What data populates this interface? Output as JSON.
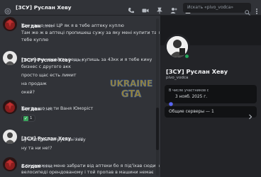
{
  "header": {
    "title": "[ЗСУ] Руслан Хеву",
    "tools": [
      "phone-icon",
      "video-icon",
      "pin-icon",
      "add-friend-icon",
      "profile-icon"
    ]
  },
  "search": {
    "placeholder": "Искать «pivo_vodca»"
  },
  "messages": [
    {
      "author": "Богдан",
      "time": "23:00",
      "lines": [
        "Так нащо мені ЦР як я в тебе аптеку куплю",
        "Там же ж в аптеці пропишеш сужу за яку мені купити та я в",
        "тебе куплю"
      ]
    },
    {
      "author": "[ЗСУ] Руслан Хеву",
      "time": "23:00",
      "lines": [
        "ты у меня какой-то вещь купишь за 43кк и я тебе кину",
        "бизнес с другого акк",
        "просто щас есть лимит",
        "на продаж",
        "окей?"
      ]
    },
    {
      "author": "Богдан",
      "time": "23:02",
      "lines": [
        "Так ти що це ти Ваня Юморіст"
      ],
      "reaction": {
        "emoji": "✓",
        "count": "1"
      }
    },
    {
      "author": "[ЗСУ] Руслан Хеву",
      "time": "23:02",
      "lines": [
        "ну а второй ак руслан хеву",
        "ну та ни не!?"
      ]
    },
    {
      "author": "Богдан",
      "time": "23:03",
      "lines": [
        "А ти зможеш мене забрати від аптеки бо я під'їхав сюди на",
        "велосипеді орендованому і той пропав в машини немає"
      ]
    }
  ],
  "watermark": {
    "line1": "UKRAINE",
    "line2": "GTA"
  },
  "profile": {
    "name": "[ЗСУ] Руслан Хеву",
    "handle": "pivo_vodca",
    "member_since_label": "В числе участников с",
    "member_since_date": "3 нояб. 2025 г.",
    "mutual_servers": "Общие серверы — 1"
  },
  "colors": {
    "background": "#313338",
    "panel": "#232428",
    "online": "#23a55a",
    "reaction_check": "#3ba55d"
  }
}
